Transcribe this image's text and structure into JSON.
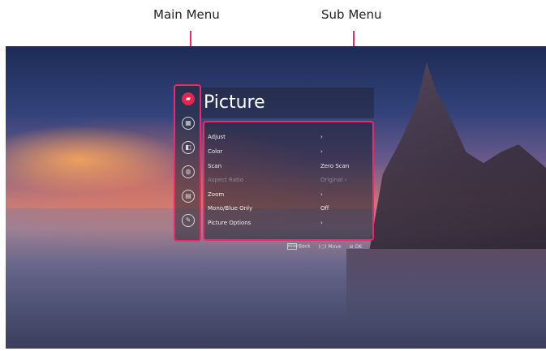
{
  "callouts": {
    "main_menu": "Main Menu",
    "sub_menu": "Sub Menu",
    "color": "#ea2a6a"
  },
  "main_menu": {
    "icons": [
      {
        "name": "picture-icon",
        "glyph": "▰",
        "active": true
      },
      {
        "name": "sound-icon",
        "glyph": "▦",
        "active": false
      },
      {
        "name": "time-icon",
        "glyph": "◧",
        "active": false
      },
      {
        "name": "network-icon",
        "glyph": "◍",
        "active": false
      },
      {
        "name": "option-icon",
        "glyph": "▤",
        "active": false
      },
      {
        "name": "support-icon",
        "glyph": "✎",
        "active": false
      }
    ],
    "active_color": "#e3264f"
  },
  "sub_menu": {
    "title": "Picture",
    "items": [
      {
        "label": "Adjust",
        "value": "›",
        "disabled": false
      },
      {
        "label": "Color",
        "value": "›",
        "disabled": false
      },
      {
        "label": "Scan",
        "value": "Zero Scan",
        "disabled": false
      },
      {
        "label": "Aspect Ratio",
        "value": "Original ›",
        "disabled": true
      },
      {
        "label": "Zoom",
        "value": "›",
        "disabled": false
      },
      {
        "label": "Mono/Blue Only",
        "value": "Off",
        "disabled": false
      },
      {
        "label": "Picture Options",
        "value": "›",
        "disabled": false
      }
    ]
  },
  "footer": {
    "back_key": "MENU",
    "back": "Back",
    "move_glyph": "(○)",
    "move": "Move",
    "ok_glyph": "⊖",
    "ok": "OK"
  }
}
